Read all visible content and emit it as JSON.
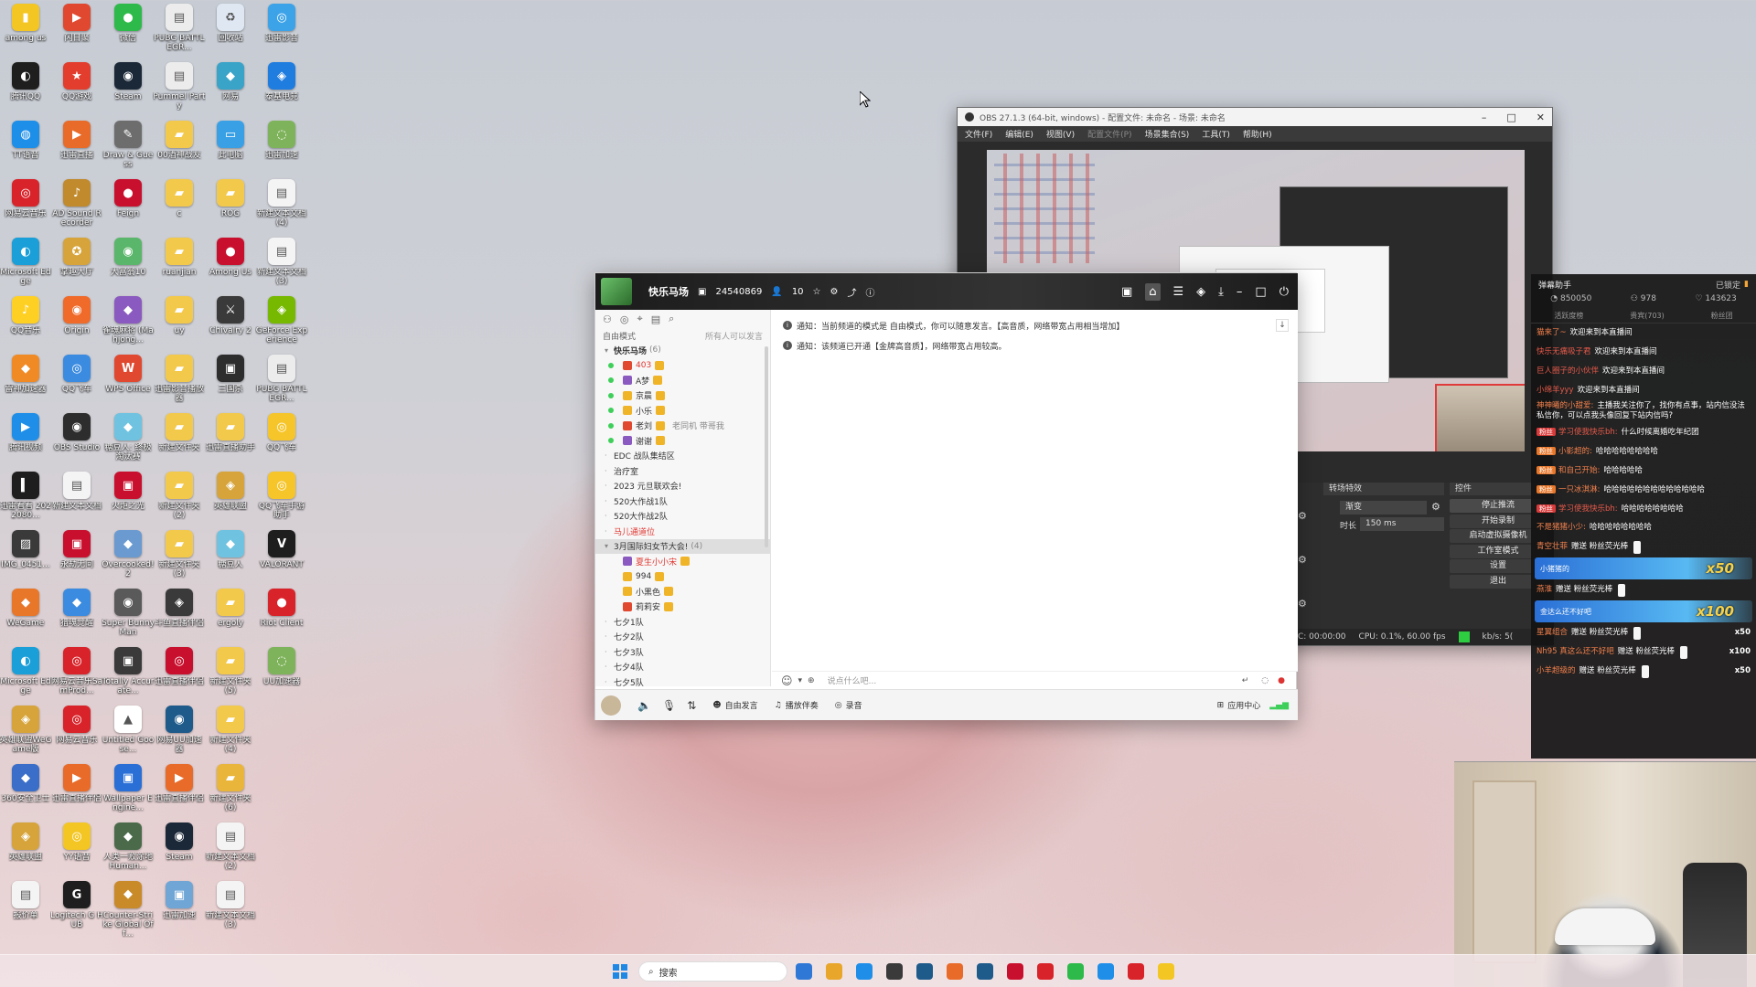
{
  "desktop": {
    "icons": [
      {
        "label": "among us",
        "color": "#f3c623",
        "glyph": "▮",
        "col": 0,
        "row": 0
      },
      {
        "label": "闪目聚",
        "color": "#e0482f",
        "glyph": "▶",
        "col": 1,
        "row": 0
      },
      {
        "label": "微信",
        "color": "#2dba4a",
        "glyph": "●",
        "col": 2,
        "row": 0
      },
      {
        "label": "PUBG BATTLEGR...",
        "color": "#ececec",
        "glyph": "▤",
        "col": 3,
        "row": 0
      },
      {
        "label": "回收站",
        "color": "#dfe7f2",
        "glyph": "♻",
        "col": 4,
        "row": 0
      },
      {
        "label": "迅雷影音",
        "color": "#3da3e8",
        "glyph": "◎",
        "col": 5,
        "row": 0
      },
      {
        "label": "腾讯QQ",
        "color": "#1e1e1e",
        "glyph": "◐",
        "col": 0,
        "row": 1
      },
      {
        "label": "QQ游戏",
        "color": "#e23d2d",
        "glyph": "★",
        "col": 1,
        "row": 1
      },
      {
        "label": "Steam",
        "color": "#1b2838",
        "glyph": "◉",
        "col": 2,
        "row": 1
      },
      {
        "label": "Pummel Party",
        "color": "#ececec",
        "glyph": "▤",
        "col": 3,
        "row": 1
      },
      {
        "label": "网易",
        "color": "#3aa3c8",
        "glyph": "◆",
        "col": 4,
        "row": 1
      },
      {
        "label": "泰基电竞",
        "color": "#1f7de0",
        "glyph": "◈",
        "col": 5,
        "row": 1
      },
      {
        "label": "TT语音",
        "color": "#1d8fe8",
        "glyph": "◍",
        "col": 0,
        "row": 2
      },
      {
        "label": "迅雷直播",
        "color": "#e86b2a",
        "glyph": "▶",
        "col": 1,
        "row": 2
      },
      {
        "label": "Draw & Guess",
        "color": "#6d6d6d",
        "glyph": "✎",
        "col": 2,
        "row": 2
      },
      {
        "label": "00酒神战友",
        "color": "#f3c94b",
        "glyph": "▰",
        "col": 3,
        "row": 2
      },
      {
        "label": "此电脑",
        "color": "#3aa0e6",
        "glyph": "▭",
        "col": 4,
        "row": 2
      },
      {
        "label": "迅雷加速",
        "color": "#7fb35b",
        "glyph": "◌",
        "col": 5,
        "row": 2
      },
      {
        "label": "网易云音乐",
        "color": "#d8232a",
        "glyph": "◎",
        "col": 0,
        "row": 3
      },
      {
        "label": "AD Sound Recorder",
        "color": "#c18a2c",
        "glyph": "♪",
        "col": 1,
        "row": 3
      },
      {
        "label": "Feign",
        "color": "#c8102e",
        "glyph": "●",
        "col": 2,
        "row": 3
      },
      {
        "label": "c",
        "color": "#f3c94b",
        "glyph": "▰",
        "col": 3,
        "row": 3
      },
      {
        "label": "ROG",
        "color": "#f3c94b",
        "glyph": "▰",
        "col": 4,
        "row": 3
      },
      {
        "label": "新建文本文档 (4)",
        "color": "#f4f4f4",
        "glyph": "▤",
        "col": 5,
        "row": 3
      },
      {
        "label": "Microsoft Edge",
        "color": "#1a9fd8",
        "glyph": "◐",
        "col": 0,
        "row": 4
      },
      {
        "label": "掌趣大厅",
        "color": "#d6a43a",
        "glyph": "✪",
        "col": 1,
        "row": 4
      },
      {
        "label": "大富翁10",
        "color": "#5ab66a",
        "glyph": "◉",
        "col": 2,
        "row": 4
      },
      {
        "label": "ruanjian",
        "color": "#f3c94b",
        "glyph": "▰",
        "col": 3,
        "row": 4
      },
      {
        "label": "Among Us",
        "color": "#c8102e",
        "glyph": "●",
        "col": 4,
        "row": 4
      },
      {
        "label": "新建文本文档 (3)",
        "color": "#f4f4f4",
        "glyph": "▤",
        "col": 5,
        "row": 4
      },
      {
        "label": "QQ音乐",
        "color": "#ffd024",
        "glyph": "♪",
        "col": 0,
        "row": 5
      },
      {
        "label": "Origin",
        "color": "#f06a2a",
        "glyph": "◉",
        "col": 1,
        "row": 5
      },
      {
        "label": "雀魂麻将 (Mahjong...",
        "color": "#8a5ac0",
        "glyph": "◆",
        "col": 2,
        "row": 5
      },
      {
        "label": "uy",
        "color": "#f3c94b",
        "glyph": "▰",
        "col": 3,
        "row": 5
      },
      {
        "label": "Chivalry 2",
        "color": "#3a3a3a",
        "glyph": "⚔",
        "col": 4,
        "row": 5
      },
      {
        "label": "GeForce Experience",
        "color": "#76b900",
        "glyph": "◈",
        "col": 5,
        "row": 5
      },
      {
        "label": "雷神加速器",
        "color": "#f08a24",
        "glyph": "◆",
        "col": 0,
        "row": 6
      },
      {
        "label": "QQ飞车",
        "color": "#3b8be0",
        "glyph": "◎",
        "col": 1,
        "row": 6
      },
      {
        "label": "WPS Office",
        "color": "#e0482f",
        "glyph": "W",
        "col": 2,
        "row": 6
      },
      {
        "label": "迅雷影音播放器",
        "color": "#f3c94b",
        "glyph": "▰",
        "col": 3,
        "row": 6
      },
      {
        "label": "三国杀",
        "color": "#2d2d2d",
        "glyph": "▣",
        "col": 4,
        "row": 6
      },
      {
        "label": "PUBG BATTLEGR...",
        "color": "#ececec",
        "glyph": "▤",
        "col": 5,
        "row": 6
      },
      {
        "label": "腾讯视频",
        "color": "#1f8ee8",
        "glyph": "▶",
        "col": 0,
        "row": 7
      },
      {
        "label": "OBS Studio",
        "color": "#2d2d2d",
        "glyph": "◉",
        "col": 1,
        "row": 7
      },
      {
        "label": "糖豆人: 终极淘汰赛",
        "color": "#6fc3e0",
        "glyph": "◆",
        "col": 2,
        "row": 7
      },
      {
        "label": "新建文件夹",
        "color": "#f3c94b",
        "glyph": "▰",
        "col": 3,
        "row": 7
      },
      {
        "label": "迅雷直播助手",
        "color": "#f3c94b",
        "glyph": "▰",
        "col": 4,
        "row": 7
      },
      {
        "label": "QQ飞车",
        "color": "#f6c52a",
        "glyph": "◎",
        "col": 5,
        "row": 7
      },
      {
        "label": "迅雷看看 2022080...",
        "color": "#1e1e1e",
        "glyph": "▍",
        "col": 0,
        "row": 8
      },
      {
        "label": "新建文本文档",
        "color": "#f4f4f4",
        "glyph": "▤",
        "col": 1,
        "row": 8
      },
      {
        "label": "火炬之光",
        "color": "#c8102e",
        "glyph": "▣",
        "col": 2,
        "row": 8
      },
      {
        "label": "新建文件夹 (2)",
        "color": "#f3c94b",
        "glyph": "▰",
        "col": 3,
        "row": 8
      },
      {
        "label": "英雄联盟",
        "color": "#d6a43a",
        "glyph": "◈",
        "col": 4,
        "row": 8
      },
      {
        "label": "QQ飞车手游助手",
        "color": "#f6c52a",
        "glyph": "◎",
        "col": 5,
        "row": 8
      },
      {
        "label": "IMG_0451...",
        "color": "#3a3a3a",
        "glyph": "▨",
        "col": 0,
        "row": 9
      },
      {
        "label": "永劫无间",
        "color": "#c8102e",
        "glyph": "▣",
        "col": 1,
        "row": 9
      },
      {
        "label": "Overcooked! 2",
        "color": "#6a9ad0",
        "glyph": "◆",
        "col": 2,
        "row": 9
      },
      {
        "label": "新建文件夹 (3)",
        "color": "#f3c94b",
        "glyph": "▰",
        "col": 3,
        "row": 9
      },
      {
        "label": "糖豆人",
        "color": "#6fc3e0",
        "glyph": "◆",
        "col": 4,
        "row": 9
      },
      {
        "label": "VALORANT",
        "color": "#1e1e1e",
        "glyph": "V",
        "col": 5,
        "row": 9
      },
      {
        "label": "WeGame",
        "color": "#e8772a",
        "glyph": "◆",
        "col": 0,
        "row": 10
      },
      {
        "label": "猎魂觉醒",
        "color": "#3b8be0",
        "glyph": "◆",
        "col": 1,
        "row": 10
      },
      {
        "label": "Super Bunny Man",
        "color": "#5a5a5a",
        "glyph": "◉",
        "col": 2,
        "row": 10
      },
      {
        "label": "斗鱼直播伴侣",
        "color": "#3a3a3a",
        "glyph": "◈",
        "col": 3,
        "row": 10
      },
      {
        "label": "ergoly",
        "color": "#f3c94b",
        "glyph": "▰",
        "col": 4,
        "row": 10
      },
      {
        "label": "Riot Client",
        "color": "#d8232a",
        "glyph": "●",
        "col": 5,
        "row": 10
      },
      {
        "label": "Microsoft Edge",
        "color": "#1a9fd8",
        "glyph": "◐",
        "col": 0,
        "row": 11
      },
      {
        "label": "网易云音乐SamProd...",
        "color": "#d8232a",
        "glyph": "◎",
        "col": 1,
        "row": 11
      },
      {
        "label": "Totally Accurate...",
        "color": "#3a3a3a",
        "glyph": "▣",
        "col": 2,
        "row": 11
      },
      {
        "label": "迅雷直播伴侣",
        "color": "#c8102e",
        "glyph": "◎",
        "col": 3,
        "row": 11
      },
      {
        "label": "新建文件夹 (5)",
        "color": "#f3c94b",
        "glyph": "▰",
        "col": 4,
        "row": 11
      },
      {
        "label": "UU加速器",
        "color": "#7fb35b",
        "glyph": "◌",
        "col": 5,
        "row": 11
      },
      {
        "label": "英雄联盟WeGame版",
        "color": "#d6a43a",
        "glyph": "◈",
        "col": 0,
        "row": 12
      },
      {
        "label": "网易云音乐",
        "color": "#d8232a",
        "glyph": "◎",
        "col": 1,
        "row": 12
      },
      {
        "label": "Untitled Goose...",
        "color": "#ffffff",
        "glyph": "▲",
        "col": 2,
        "row": 12
      },
      {
        "label": "网易UU加速器",
        "color": "#1e5a8a",
        "glyph": "◉",
        "col": 3,
        "row": 12
      },
      {
        "label": "新建文件夹 (4)",
        "color": "#f3c94b",
        "glyph": "▰",
        "col": 4,
        "row": 12
      },
      {
        "label": "360安全卫士",
        "color": "#3a6ec8",
        "glyph": "◆",
        "col": 0,
        "row": 13
      },
      {
        "label": "迅雷直播伴侣",
        "color": "#e86b2a",
        "glyph": "▶",
        "col": 1,
        "row": 13
      },
      {
        "label": "Wallpaper Engine...",
        "color": "#2a6fd6",
        "glyph": "▣",
        "col": 2,
        "row": 13
      },
      {
        "label": "迅雷直播伴侣",
        "color": "#e86b2a",
        "glyph": "▶",
        "col": 3,
        "row": 13
      },
      {
        "label": "新建文件夹 (6)",
        "color": "#e9b53a",
        "glyph": "▰",
        "col": 4,
        "row": 13
      },
      {
        "label": "英雄联盟",
        "color": "#d6a43a",
        "glyph": "◈",
        "col": 0,
        "row": 14
      },
      {
        "label": "YY语音",
        "color": "#f3c623",
        "glyph": "◎",
        "col": 1,
        "row": 14
      },
      {
        "label": "人类一败涂地 Human...",
        "color": "#4a6a4a",
        "glyph": "◆",
        "col": 2,
        "row": 14
      },
      {
        "label": "Steam",
        "color": "#1b2838",
        "glyph": "◉",
        "col": 3,
        "row": 14
      },
      {
        "label": "新建文本文档 (2)",
        "color": "#f4f4f4",
        "glyph": "▤",
        "col": 4,
        "row": 14
      },
      {
        "label": "报价单",
        "color": "#f4f4f4",
        "glyph": "▤",
        "col": 0,
        "row": 15
      },
      {
        "label": "Logitech G HUB",
        "color": "#1e1e1e",
        "glyph": "G",
        "col": 1,
        "row": 15
      },
      {
        "label": "Counter-Strike Global Off...",
        "color": "#c98a2a",
        "glyph": "◆",
        "col": 2,
        "row": 15
      },
      {
        "label": "迅雷加速",
        "color": "#6fa6d6",
        "glyph": "▣",
        "col": 3,
        "row": 15
      },
      {
        "label": "新建文本文档 (3)",
        "color": "#f4f4f4",
        "glyph": "▤",
        "col": 4,
        "row": 15
      }
    ]
  },
  "obs": {
    "title": "OBS 27.1.3 (64-bit, windows) - 配置文件: 未命名 - 场景: 未命名",
    "menu": [
      "文件(F)",
      "编辑(E)",
      "视图(V)",
      "配置文件(P)",
      "场景集合(S)",
      "工具(T)",
      "帮助(H)"
    ],
    "transitions_title": "转场特效",
    "controls_title": "控件",
    "transition_value": "渐变",
    "duration_label": "时长",
    "duration_value": "150 ms",
    "controls": [
      "停止推流",
      "开始录制",
      "启动虚拟摄像机",
      "工作室模式",
      "设置",
      "退出"
    ],
    "status_rec": "REC: 00:00:00",
    "status_cpu": "CPU: 0.1%, 60.00 fps",
    "status_kbps": "kb/s: 5("
  },
  "qq": {
    "channel_name": "快乐马场",
    "channel_id": "24540869",
    "member_count": "10",
    "mode_label": "自由模式",
    "mode_hint": "所有人可以发言",
    "tree": [
      {
        "type": "channel",
        "label": "快乐马场",
        "suffix": "(6)",
        "open": true
      },
      {
        "type": "user",
        "label": "403",
        "online": true,
        "red": true
      },
      {
        "type": "user",
        "label": "A梦",
        "online": true
      },
      {
        "type": "user",
        "label": "京晨",
        "online": true
      },
      {
        "type": "user",
        "label": "小乐",
        "online": true
      },
      {
        "type": "user",
        "label": "老刘",
        "online": true,
        "extra": "老同机 带哥我"
      },
      {
        "type": "user",
        "label": "谢谢",
        "online": true
      },
      {
        "type": "channel",
        "label": "EDC 战队集结区"
      },
      {
        "type": "channel",
        "label": "治疗室"
      },
      {
        "type": "channel",
        "label": "2023 元旦联欢会!"
      },
      {
        "type": "channel",
        "label": "520大作战1队"
      },
      {
        "type": "channel",
        "label": "520大作战2队"
      },
      {
        "type": "channel",
        "label": "马儿通道位",
        "red": true
      },
      {
        "type": "channel",
        "label": "3月国际妇女节大会!",
        "suffix": "(4)",
        "open": true,
        "sel": true
      },
      {
        "type": "user",
        "label": "夏生小小宋",
        "online": false,
        "red": true
      },
      {
        "type": "user",
        "label": "994",
        "online": false
      },
      {
        "type": "user",
        "label": "小黑色",
        "online": false
      },
      {
        "type": "user",
        "label": "莉莉安",
        "online": false
      },
      {
        "type": "channel",
        "label": "七夕1队"
      },
      {
        "type": "channel",
        "label": "七夕2队"
      },
      {
        "type": "channel",
        "label": "七夕3队"
      },
      {
        "type": "channel",
        "label": "七夕4队"
      },
      {
        "type": "channel",
        "label": "七夕5队"
      }
    ],
    "notice1": "通知：当前频道的模式是 自由模式，你可以随意发言。【高音质，网络带宽占用相当增加】",
    "notice2": "通知：该频道已开通【金牌高音质】，网络带宽占用较高。",
    "input_placeholder": "说点什么吧...",
    "bottom": {
      "free_talk": "自由发言",
      "play_music": "播放伴奏",
      "record": "录音",
      "app_center": "应用中心"
    }
  },
  "danmaku": {
    "title": "弹幕助手",
    "locked": "已锁定",
    "stats": [
      "850050",
      "978",
      "143623"
    ],
    "tabs": [
      "活跃度榜",
      "贵宾(703)",
      "粉丝团"
    ],
    "messages": [
      {
        "tag": "",
        "user": "猫来了~",
        "text": "欢迎来到本直播间",
        "tagcls": ""
      },
      {
        "tag": "",
        "user": "快乐无痛吸子君",
        "text": "欢迎来到本直播间",
        "tagcls": "red"
      },
      {
        "tag": "",
        "user": "巨人圈子的小伙伴",
        "text": "欢迎来到本直播间",
        "tagcls": "red"
      },
      {
        "tag": "",
        "user": "小绵羊yyy",
        "text": "欢迎来到本直播间",
        "tagcls": "red"
      },
      {
        "tag": "",
        "user": "神神曦的小甜爱:",
        "text": "主播我关注你了，找你有点事，站内信没法私信你，可以点我头像回复下站内信吗?",
        "tagcls": ""
      },
      {
        "tag": "粉丝",
        "user": "学习使我快乐bh:",
        "text": "什么时候离婚吃年纪团",
        "tagcls": "red"
      },
      {
        "tag": "粉丝",
        "user": "小影超的:",
        "text": "哈哈哈哈哈哈哈哈",
        "tagcls": "orange"
      },
      {
        "tag": "粉丝",
        "user": "和自己开始:",
        "text": "哈哈哈哈哈",
        "tagcls": "orange"
      },
      {
        "tag": "粉丝",
        "user": "一只冰淇淋:",
        "text": "哈哈哈哈哈哈哈哈哈哈哈哈哈",
        "tagcls": "orange"
      },
      {
        "tag": "粉丝",
        "user": "学习使我快乐bh:",
        "text": "哈哈哈哈哈哈哈哈",
        "tagcls": "red"
      },
      {
        "tag": "",
        "user": "不是猪猪小少:",
        "text": "哈哈哈哈哈哈哈哈",
        "tagcls": ""
      }
    ],
    "gifts": [
      {
        "user": "青空壮菲",
        "text": "赠送 粉丝荧光棒",
        "count": ""
      },
      {
        "user": "小猪猪的",
        "text": "赠送 粉丝荧光棒",
        "count": "x50"
      },
      {
        "user": "燕淮",
        "text": "赠送 粉丝荧光棒",
        "count": ""
      },
      {
        "user": "金达么还不好吧",
        "text": "赠送 粉丝荧光棒",
        "count": "x100"
      },
      {
        "user": "星翼组合",
        "text": "赠送 粉丝荧光棒",
        "count": "x50"
      },
      {
        "user": "Nh95 真这么还不好吧",
        "text": "赠送 粉丝荧光棒",
        "count": "x100"
      },
      {
        "user": "小羊超级的",
        "text": "赠送 粉丝荧光棒",
        "count": "x50"
      }
    ],
    "banner1": "x50",
    "banner2": "x100"
  },
  "taskbar": {
    "search_placeholder": "搜索",
    "apps": [
      "#2f78d6",
      "#e8a62a",
      "#1f8ee8",
      "#3a3a3a",
      "#1e5a8a",
      "#e86b2a",
      "#1e5a8a",
      "#c8102e",
      "#d8232a",
      "#2dba4a",
      "#1f8ee8",
      "#d8232a",
      "#f3c623"
    ]
  }
}
